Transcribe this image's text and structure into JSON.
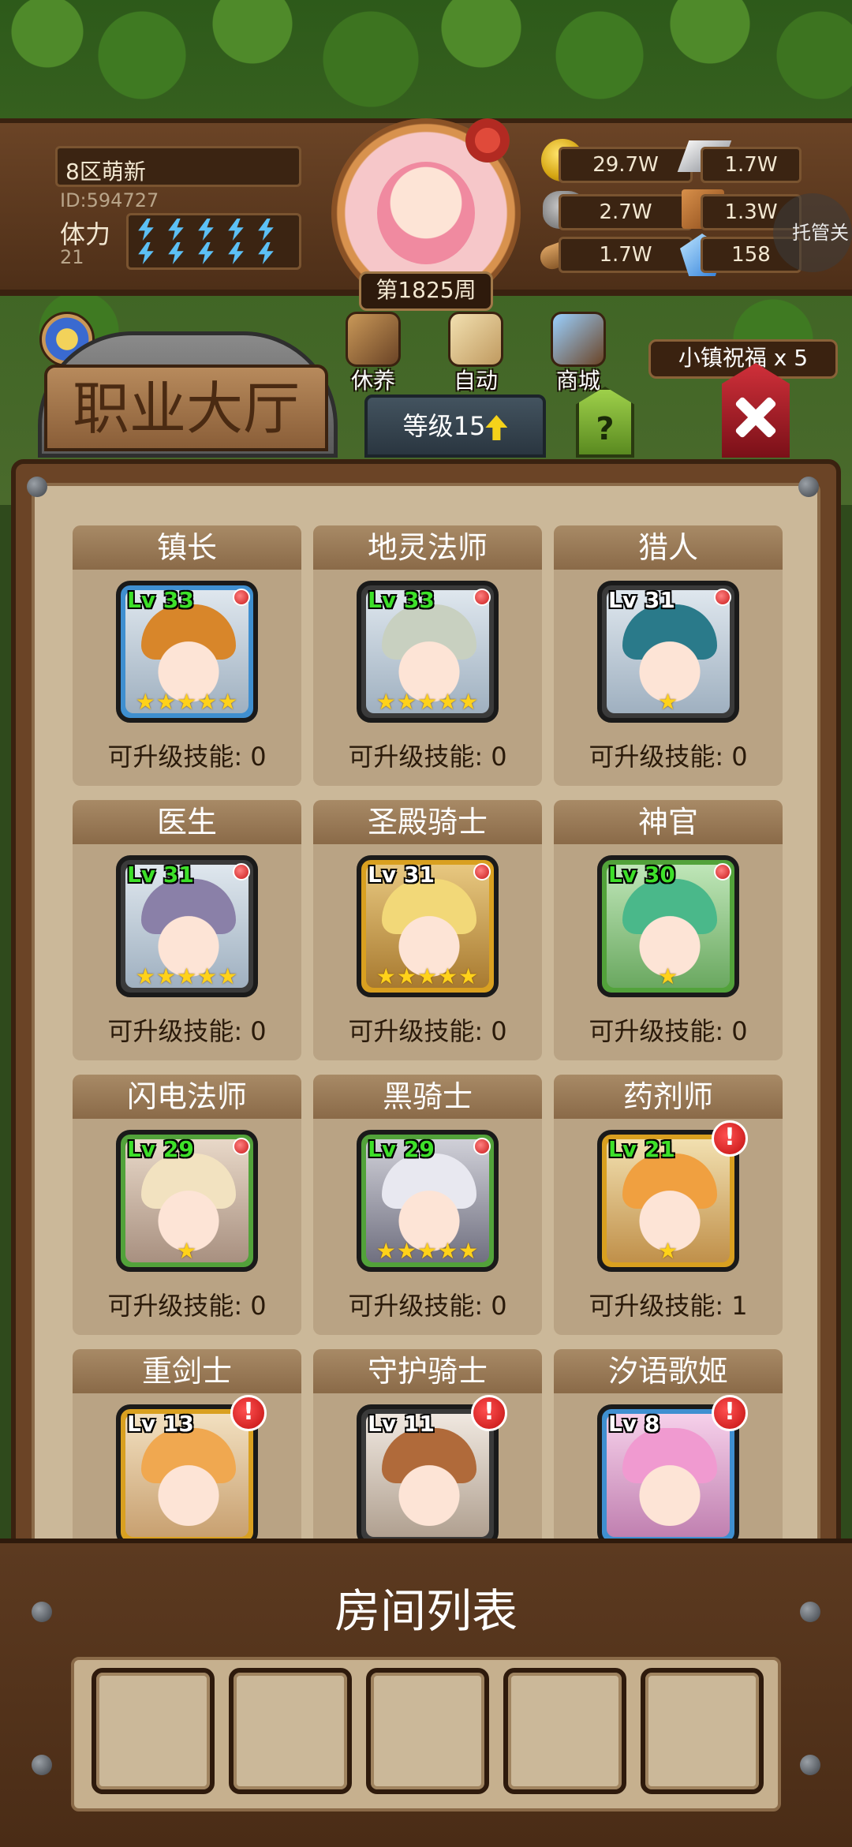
{
  "player": {
    "server_name": "8区萌新",
    "id": "ID:594727",
    "stamina_label": "体力",
    "stamina_value": "21",
    "stamina_bolts": 10,
    "week": "第1825周"
  },
  "resources": {
    "gold": "29.7W",
    "silver": "1.7W",
    "ore": "2.7W",
    "scroll": "1.3W",
    "wood": "1.7W",
    "crystal": "158"
  },
  "auto_toggle": "托管关",
  "nav": {
    "rest": "休养",
    "auto": "自动",
    "shop": "商城",
    "blessing": "小镇祝福 x 5"
  },
  "hall": {
    "title": "职业大厅",
    "level": "等级15",
    "help": "?"
  },
  "jobs": [
    {
      "name": "镇长",
      "level": "Lv 33",
      "stars": "★★★★★",
      "skill": "可升级技能: 0"
    },
    {
      "name": "地灵法师",
      "level": "Lv 33",
      "stars": "★★★★★",
      "skill": "可升级技能: 0"
    },
    {
      "name": "猎人",
      "level": "Lv 31",
      "stars": "★",
      "skill": "可升级技能: 0"
    },
    {
      "name": "医生",
      "level": "Lv 31",
      "stars": "★★★★★",
      "skill": "可升级技能: 0"
    },
    {
      "name": "圣殿骑士",
      "level": "Lv 31",
      "stars": "★★★★★",
      "skill": "可升级技能: 0"
    },
    {
      "name": "神官",
      "level": "Lv 30",
      "stars": "★",
      "skill": "可升级技能: 0"
    },
    {
      "name": "闪电法师",
      "level": "Lv 29",
      "stars": "★",
      "skill": "可升级技能: 0"
    },
    {
      "name": "黑骑士",
      "level": "Lv 29",
      "stars": "★★★★★",
      "skill": "可升级技能: 0"
    },
    {
      "name": "药剂师",
      "level": "Lv 21",
      "stars": "★",
      "skill": "可升级技能: 1"
    },
    {
      "name": "重剑士",
      "level": "Lv 13",
      "stars": "",
      "skill": ""
    },
    {
      "name": "守护骑士",
      "level": "Lv 11",
      "stars": "",
      "skill": ""
    },
    {
      "name": "汐语歌姬",
      "level": "Lv 8",
      "stars": "",
      "skill": ""
    }
  ],
  "alert_mark": "!",
  "room": {
    "title": "房间列表"
  }
}
